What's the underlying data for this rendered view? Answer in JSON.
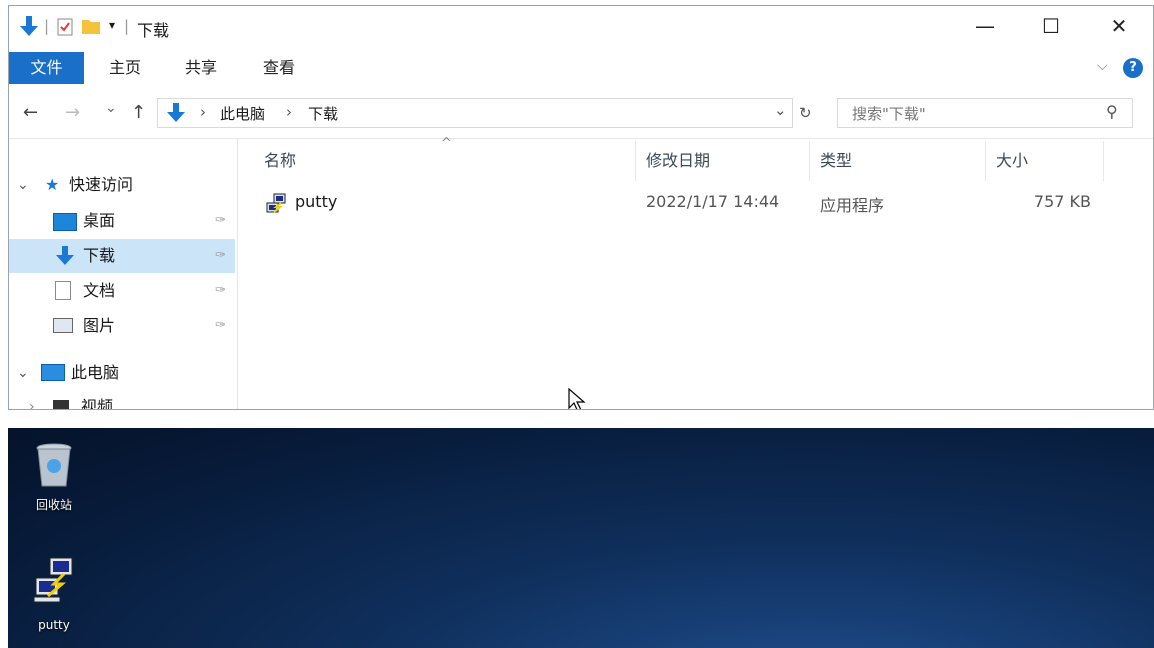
{
  "window": {
    "title": "下载",
    "qat_separator": "|",
    "qat_dropdown": "▾",
    "minimize": "—",
    "maximize": "☐",
    "close": "✕"
  },
  "ribbon": {
    "tabs": [
      {
        "label": "文件"
      },
      {
        "label": "主页"
      },
      {
        "label": "共享"
      },
      {
        "label": "查看"
      }
    ],
    "expand": "⌵",
    "help": "?"
  },
  "address": {
    "back": "←",
    "forward": "→",
    "recent": "⌄",
    "up": "↑",
    "crumbs": [
      "此电脑",
      "下载"
    ],
    "crumb_sep": "›",
    "dropdown": "⌄",
    "refresh": "↻",
    "search_placeholder": "搜索\"下载\"",
    "search_icon": "⚲"
  },
  "nav": {
    "quick_access": "快速访问",
    "items": [
      {
        "label": "桌面",
        "pinned": true
      },
      {
        "label": "下载",
        "pinned": true
      },
      {
        "label": "文档",
        "pinned": true
      },
      {
        "label": "图片",
        "pinned": true
      }
    ],
    "this_pc": "此电脑",
    "videos": "视频",
    "pin_glyph": "✑",
    "expand_glyph": "⌄",
    "collapsed_glyph": "›"
  },
  "columns": {
    "sort_arrow": "^",
    "name": "名称",
    "date": "修改日期",
    "type": "类型",
    "size": "大小"
  },
  "files": [
    {
      "name": "putty",
      "date": "2022/1/17 14:44",
      "type": "应用程序",
      "size": "757 KB"
    }
  ],
  "desktop": {
    "icons": [
      {
        "label": "回收站",
        "icon": "recycle-bin-icon"
      },
      {
        "label": "putty",
        "icon": "putty-icon"
      }
    ]
  },
  "colors": {
    "file_tab": "#1a6fc9",
    "selected_nav": "#cce4f7",
    "download_arrow": "#1a78d6",
    "desktop_bg": "#0a2247"
  }
}
